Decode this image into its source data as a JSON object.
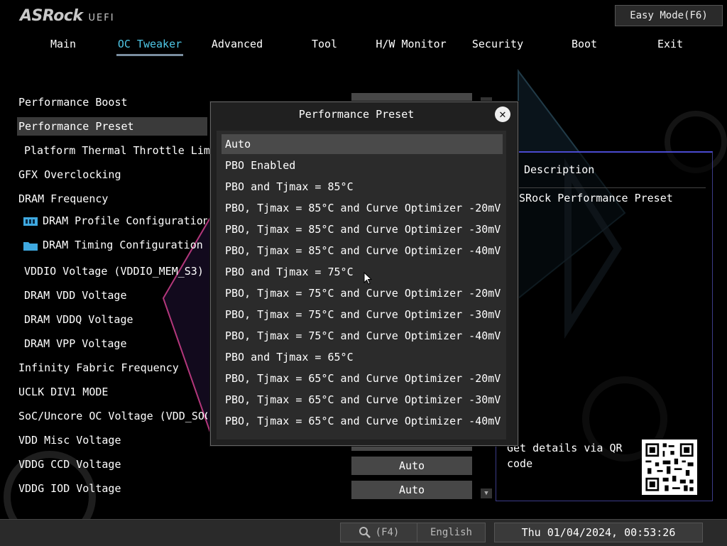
{
  "brand": {
    "logo": "ASRock",
    "sub": "UEFI"
  },
  "header": {
    "easy_mode_button": "Easy Mode(F6)"
  },
  "tabs": [
    {
      "label": "Main"
    },
    {
      "label": "OC Tweaker",
      "active": true
    },
    {
      "label": "Advanced"
    },
    {
      "label": "Tool"
    },
    {
      "label": "H/W Monitor"
    },
    {
      "label": "Security"
    },
    {
      "label": "Boot"
    },
    {
      "label": "Exit"
    }
  ],
  "menu": [
    {
      "label": "Performance Boost"
    },
    {
      "label": "Performance Preset",
      "selected": true
    },
    {
      "label": "Platform Thermal Throttle Limit(Tj"
    },
    {
      "label": "GFX Overclocking"
    },
    {
      "label": "DRAM Frequency"
    },
    {
      "label": "DRAM Profile Configuration",
      "icon": "memory-icon"
    },
    {
      "label": "DRAM Timing Configuration",
      "icon": "folder-icon"
    },
    {
      "label": "VDDIO Voltage (VDDIO_MEM_S3)"
    },
    {
      "label": "DRAM VDD Voltage"
    },
    {
      "label": "DRAM VDDQ Voltage"
    },
    {
      "label": "DRAM VPP Voltage"
    },
    {
      "label": "Infinity Fabric Frequency"
    },
    {
      "label": "UCLK DIV1 MODE"
    },
    {
      "label": "SoC/Uncore OC Voltage (VDD_SOC)"
    },
    {
      "label": "VDD Misc Voltage"
    },
    {
      "label": "VDDG CCD Voltage"
    },
    {
      "label": "VDDG IOD Voltage"
    }
  ],
  "values": {
    "vddg_ccd": "Auto",
    "vddg_iod": "Auto"
  },
  "description": {
    "heading": "Description",
    "text": "ASRock Performance Preset",
    "qr_text": "Get details via QR code"
  },
  "dialog": {
    "title": "Performance Preset",
    "options": [
      "Auto",
      "PBO Enabled",
      "PBO and Tjmax = 85°C",
      "PBO, Tjmax = 85°C and Curve Optimizer -20mV",
      "PBO, Tjmax = 85°C and Curve Optimizer -30mV",
      "PBO, Tjmax = 85°C and Curve Optimizer -40mV",
      "PBO and Tjmax = 75°C",
      "PBO, Tjmax = 75°C and Curve Optimizer -20mV",
      "PBO, Tjmax = 75°C and Curve Optimizer -30mV",
      "PBO, Tjmax = 75°C and Curve Optimizer -40mV",
      "PBO and Tjmax = 65°C",
      "PBO, Tjmax = 65°C and Curve Optimizer -20mV",
      "PBO, Tjmax = 65°C and Curve Optimizer -30mV",
      "PBO, Tjmax = 65°C and Curve Optimizer -40mV"
    ],
    "selected_index": 0
  },
  "footer": {
    "search_label": "(F4)",
    "language": "English",
    "datetime": "Thu 01/04/2024, 00:53:26"
  },
  "colors": {
    "accent": "#4fc8e8",
    "panel_border": "#4a4acf",
    "value_bg": "#474747"
  }
}
